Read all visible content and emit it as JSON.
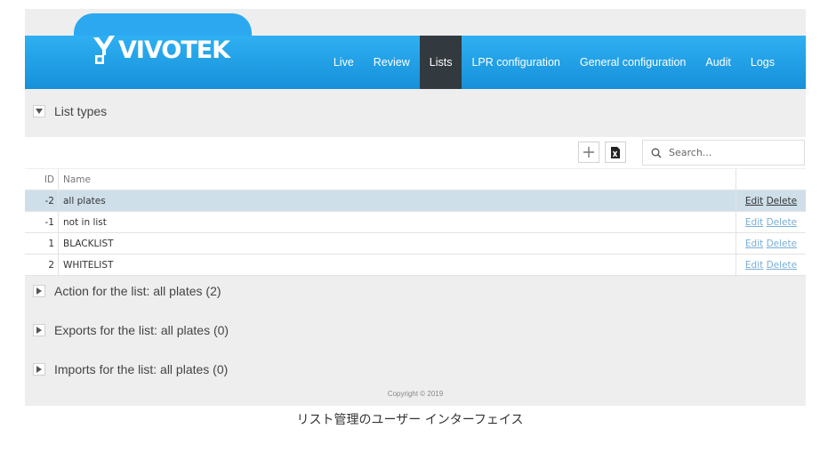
{
  "brand": {
    "logo_text": "VIVOTEK",
    "color": "#1a9ce3"
  },
  "nav": {
    "items": [
      "Live",
      "Review",
      "Lists",
      "LPR configuration",
      "General configuration",
      "Audit",
      "Logs"
    ],
    "active": "Lists"
  },
  "sections": {
    "list_types": "List types",
    "action": "Action for the list: all plates (2)",
    "exports": "Exports for the list: all plates (0)",
    "imports": "Imports for the list: all plates (0)"
  },
  "toolbar": {
    "add_icon": "plus-icon",
    "import_icon": "excel-file-icon",
    "search_placeholder": "Search..."
  },
  "table": {
    "headers": {
      "id": "ID",
      "name": "Name"
    },
    "rows": [
      {
        "id": "-2",
        "name": "all plates",
        "edit": "Edit",
        "delete": "Delete",
        "selected": true
      },
      {
        "id": "-1",
        "name": "not in list",
        "edit": "Edit",
        "delete": "Delete"
      },
      {
        "id": "1",
        "name": "BLACKLIST",
        "edit": "Edit",
        "delete": "Delete"
      },
      {
        "id": "2",
        "name": "WHITELIST",
        "edit": "Edit",
        "delete": "Delete"
      }
    ]
  },
  "footer": {
    "copyright": "Copyright © 2019"
  },
  "caption": "リスト管理のユーザー インターフェイス"
}
